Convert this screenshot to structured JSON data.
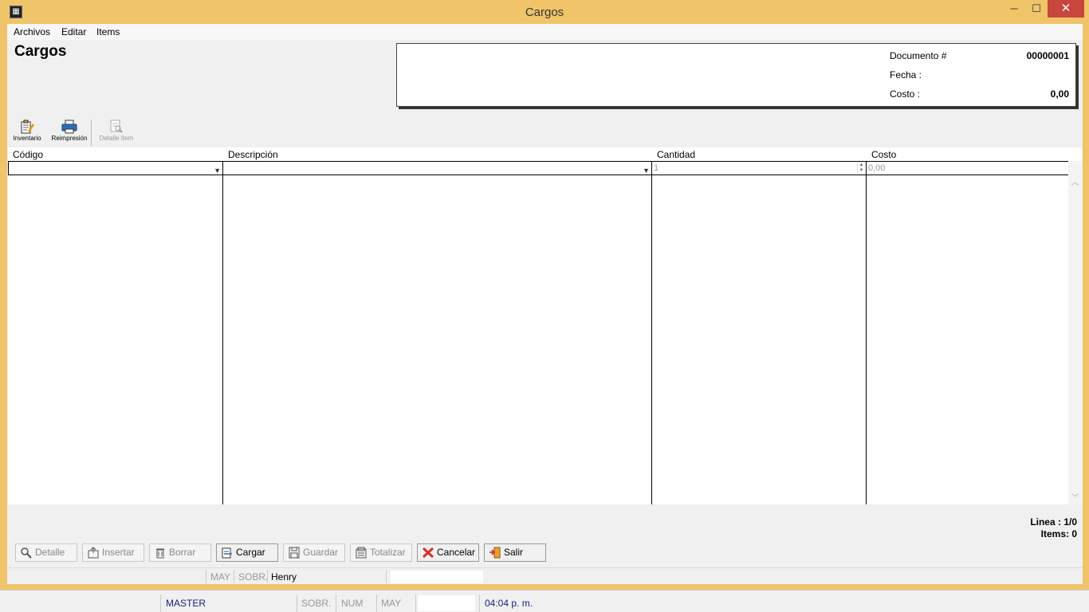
{
  "window": {
    "title": "Cargos",
    "minimize": "─",
    "maximize": "☐",
    "close": "✕"
  },
  "menu": {
    "archivos": "Archivos",
    "editar": "Editar",
    "items": "Items"
  },
  "form": {
    "title": "Cargos"
  },
  "document": {
    "doc_label": "Documento #",
    "doc_value": "00000001",
    "fecha_label": "Fecha :",
    "fecha_value": "",
    "costo_label": "Costo :",
    "costo_value": "0,00"
  },
  "toolbar": {
    "inventario": "Inventario",
    "reimpresion": "Reimpresión",
    "detalle_item": "Detalle Item"
  },
  "grid": {
    "columns": [
      "Código",
      "Descripción",
      "Cantidad",
      "Costo"
    ],
    "edit_row": {
      "codigo": "",
      "descripcion": "",
      "cantidad": "1",
      "costo": "0,00"
    }
  },
  "info": {
    "linea": "Linea : 1/0",
    "items": "Items: 0"
  },
  "buttons": {
    "detalle": "Detalle",
    "insertar": "Insertar",
    "borrar": "Borrar",
    "cargar": "Cargar",
    "guardar": "Guardar",
    "totalizar": "Totalizar",
    "cancelar": "Cancelar",
    "salir": "Salir"
  },
  "inner_status": {
    "may": "MAY",
    "sobr": "SOBR.",
    "user": "Henry"
  },
  "outer_status": {
    "master": "MASTER",
    "sobr": "SOBR.",
    "num": "NUM",
    "may": "MAY",
    "time": "04:04 p. m."
  },
  "colors": {
    "frame": "#f0c469",
    "close": "#c7473f",
    "status_blue": "#1a237e",
    "cancel_red": "#d32f2f"
  }
}
